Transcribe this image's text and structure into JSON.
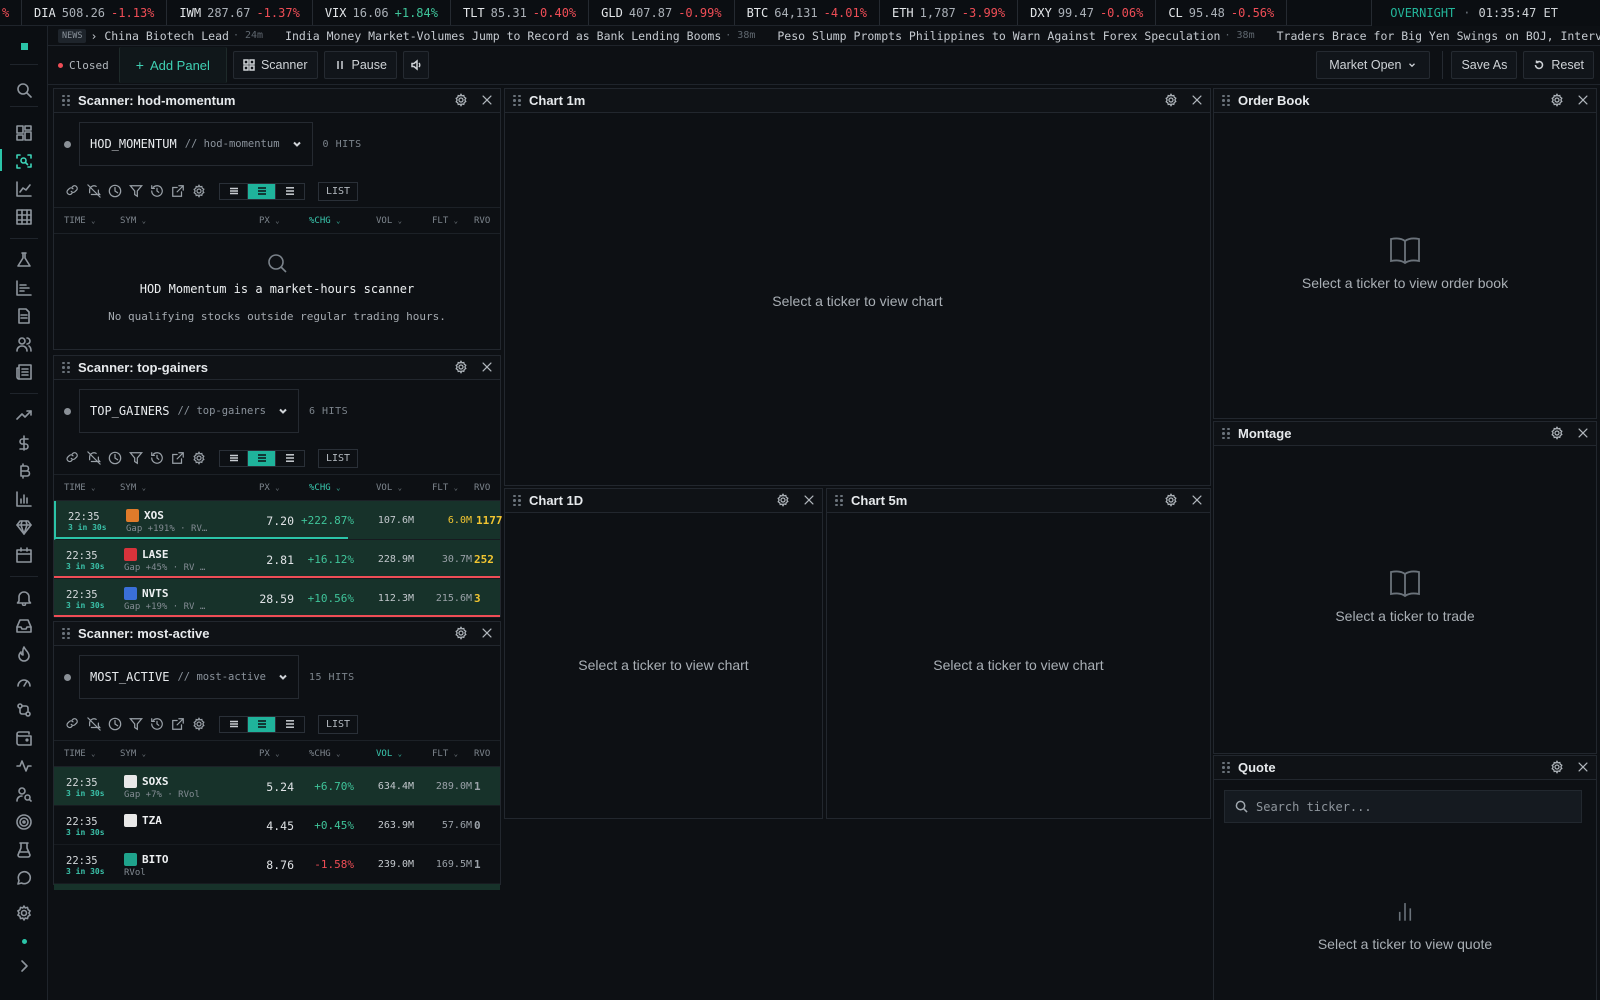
{
  "ticker_tape": [
    {
      "sym": "",
      "px": "",
      "chg": "%",
      "dir": "neg"
    },
    {
      "sym": "DIA",
      "px": "508.26",
      "chg": "-1.13%",
      "dir": "neg"
    },
    {
      "sym": "IWM",
      "px": "287.67",
      "chg": "-1.37%",
      "dir": "neg"
    },
    {
      "sym": "VIX",
      "px": "16.06",
      "chg": "+1.84%",
      "dir": "pos"
    },
    {
      "sym": "TLT",
      "px": "85.31",
      "chg": "-0.40%",
      "dir": "neg"
    },
    {
      "sym": "GLD",
      "px": "407.87",
      "chg": "-0.99%",
      "dir": "neg"
    },
    {
      "sym": "BTC",
      "px": "64,131",
      "chg": "-4.01%",
      "dir": "neg"
    },
    {
      "sym": "ETH",
      "px": "1,787",
      "chg": "-3.99%",
      "dir": "neg"
    },
    {
      "sym": "DXY",
      "px": "99.47",
      "chg": "-0.06%",
      "dir": "neg"
    },
    {
      "sym": "CL",
      "px": "95.48",
      "chg": "-0.56%",
      "dir": "neg"
    }
  ],
  "session": {
    "label": "OVERNIGHT",
    "separator": "·",
    "time": "01:35:47 ET"
  },
  "news": {
    "badge": "NEWS",
    "items": [
      {
        "text": "› China Biotech Lead",
        "age": "· 24m"
      },
      {
        "text": "India Money Market-Volumes Jump to Record as Bank Lending Booms",
        "age": "· 38m"
      },
      {
        "text": "Peso Slump Prompts Philippines to Warn Against Forex Speculation",
        "age": "· 38m"
      },
      {
        "text": "Traders Brace for Big Yen Swings on BOJ, Intervent",
        "age": ""
      }
    ]
  },
  "toolbar": {
    "status": "Closed",
    "add_panel": "Add Panel",
    "scanner": "Scanner",
    "pause": "Pause",
    "layout": "Market Open",
    "save_as": "Save As",
    "reset": "Reset"
  },
  "sidebar_icons": [
    "logo-icon",
    "search-icon",
    "dashboard-icon",
    "scanner-icon",
    "chart-icon",
    "grid-icon",
    "flask-icon",
    "bar-chart-icon",
    "document-icon",
    "users-icon",
    "news-icon",
    "trending-icon",
    "dollar-icon",
    "bitcoin-icon",
    "stats-icon",
    "gem-icon",
    "calendar-icon",
    "bell-icon",
    "inbox-icon",
    "flame-icon",
    "gauge-icon",
    "swap-icon",
    "wallet-icon",
    "activity-icon",
    "user-search-icon",
    "target-icon",
    "beaker-icon",
    "chat-icon",
    "settings-icon",
    "status-dot-icon",
    "expand-icon"
  ],
  "columns": {
    "time": "TIME",
    "sym": "SYM",
    "px": "PX",
    "chg": "%CHG",
    "vol": "VOL",
    "flt": "FLT",
    "rvol": "RVO"
  },
  "panels": {
    "scanner_hod": {
      "title": "Scanner: hod-momentum",
      "name": "HOD_MOMENTUM",
      "slug": "// hod-momentum",
      "hits": "0 HITS",
      "list": "LIST",
      "empty_title": "HOD Momentum is a market-hours scanner",
      "empty_text": "No qualifying stocks outside regular trading hours."
    },
    "scanner_gainers": {
      "title": "Scanner: top-gainers",
      "name": "TOP_GAINERS",
      "slug": "// top-gainers",
      "hits": "6 HITS",
      "list": "LIST",
      "rows": [
        {
          "time": "22:35",
          "count": "3 in 30s",
          "sym": "XOS",
          "sub": "Gap +191% · RV…",
          "px": "7.20",
          "chg": "+222.87%",
          "vol": "107.6M",
          "flt": "6.0M",
          "rvol": "1177",
          "logo": "#e07b2a",
          "rvol_color": "#f2c531"
        },
        {
          "time": "22:35",
          "count": "3 in 30s",
          "sym": "LASE",
          "sub": "Gap +45% · RV …",
          "px": "2.81",
          "chg": "+16.12%",
          "vol": "228.9M",
          "flt": "30.7M",
          "rvol": "252",
          "logo": "#d8333b",
          "rvol_color": "#f2c531"
        },
        {
          "time": "22:35",
          "count": "3 in 30s",
          "sym": "NVTS",
          "sub": "Gap +19% · RV …",
          "px": "28.59",
          "chg": "+10.56%",
          "vol": "112.3M",
          "flt": "215.6M",
          "rvol": "3",
          "logo": "#3a6fd8",
          "rvol_color": "#f2c531"
        }
      ]
    },
    "scanner_active": {
      "title": "Scanner: most-active",
      "name": "MOST_ACTIVE",
      "slug": "// most-active",
      "hits": "15 HITS",
      "list": "LIST",
      "rows": [
        {
          "time": "22:35",
          "count": "3 in 30s",
          "sym": "SOXS",
          "sub": "Gap +7% · RVol",
          "px": "5.24",
          "chg": "+6.70%",
          "vol": "634.4M",
          "flt": "289.0M",
          "rvol": "1",
          "logo": "#e8e8e8",
          "dir": "pos"
        },
        {
          "time": "22:35",
          "count": "3 in 30s",
          "sym": "TZA",
          "sub": "",
          "px": "4.45",
          "chg": "+0.45%",
          "vol": "263.9M",
          "flt": "57.6M",
          "rvol": "0",
          "logo": "#e8e8e8",
          "dir": "pos"
        },
        {
          "time": "22:35",
          "count": "3 in 30s",
          "sym": "BITO",
          "sub": "RVol",
          "px": "8.76",
          "chg": "-1.58%",
          "vol": "239.0M",
          "flt": "169.5M",
          "rvol": "1",
          "logo": "#1fa38c",
          "dir": "neg"
        }
      ]
    },
    "chart_1m": {
      "title": "Chart 1m",
      "empty": "Select a ticker to view chart"
    },
    "chart_1d": {
      "title": "Chart 1D",
      "empty": "Select a ticker to view chart"
    },
    "chart_5m": {
      "title": "Chart 5m",
      "empty": "Select a ticker to view chart"
    },
    "order_book": {
      "title": "Order Book",
      "empty": "Select a ticker to view order book"
    },
    "montage": {
      "title": "Montage",
      "empty": "Select a ticker to trade"
    },
    "quote": {
      "title": "Quote",
      "placeholder": "Search ticker...",
      "empty": "Select a ticker to view quote"
    }
  },
  "colors": {
    "accent": "#2bc4a8",
    "positive": "#3fc49a",
    "negative": "#ef4d56",
    "warning": "#f2c531",
    "background": "#0d1014"
  }
}
